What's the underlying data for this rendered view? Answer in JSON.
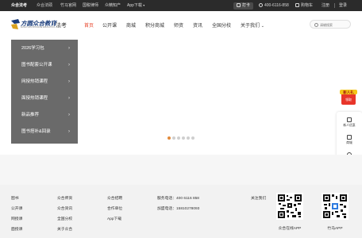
{
  "topbar": {
    "links": [
      "众合法考",
      "众合法硕",
      "竹马官网",
      "国税律师",
      "众精知产",
      "App下载"
    ],
    "punch": "打卡",
    "phone": "400-6116-858",
    "cart": "购物车",
    "register": "注册",
    "login": "登录"
  },
  "header": {
    "brand": "方圆众合教育",
    "brand_sub": "FANGYUAN ZHONGHE EDUCATION",
    "category": "法考",
    "nav": [
      "首页",
      "公开课",
      "商城",
      "积分商城",
      "师资",
      "资讯",
      "全国分校",
      "关于我们"
    ],
    "nav_more_icon": "chevron-down-icon",
    "search_placeholder": "请输搜索"
  },
  "side_menu": {
    "items": [
      "2026学习包",
      "图书配套公开课",
      "网授热销课程",
      "面授热销课程",
      "新品推荐",
      "图书搭补&回录"
    ]
  },
  "carousel": {
    "dots": 6,
    "active_dot": 0,
    "active_color": "#e28a3b"
  },
  "float": {
    "gift_line1": "新人礼",
    "gift_line2": "领取",
    "items": [
      {
        "label": "新人优惠",
        "icon": "gift-icon"
      },
      {
        "label": "商城",
        "icon": "shop-icon"
      },
      {
        "label": "关于我们",
        "icon": "info-icon"
      },
      {
        "label": "客服",
        "icon": "headset-icon"
      }
    ]
  },
  "footer": {
    "col1": [
      "图书",
      "公开课",
      "网授课",
      "面授课"
    ],
    "col2": [
      "众合师资",
      "众合资讯",
      "全国分校",
      "关于众合"
    ],
    "col3": [
      "众合招聘",
      "合作单位",
      "App下载"
    ],
    "contact_phone": "服务电话：400 6116 858",
    "contact_join": "加盟电话：15810278093",
    "follow": "关注我们",
    "qr1_caption": "众合在线APP",
    "qr2_caption": "竹马APP"
  },
  "colors": {
    "accent": "#e8462c",
    "brand": "#1a3d7c",
    "menu_bg": "#6a6a6a",
    "topbar_bg": "#2b2b2b"
  }
}
